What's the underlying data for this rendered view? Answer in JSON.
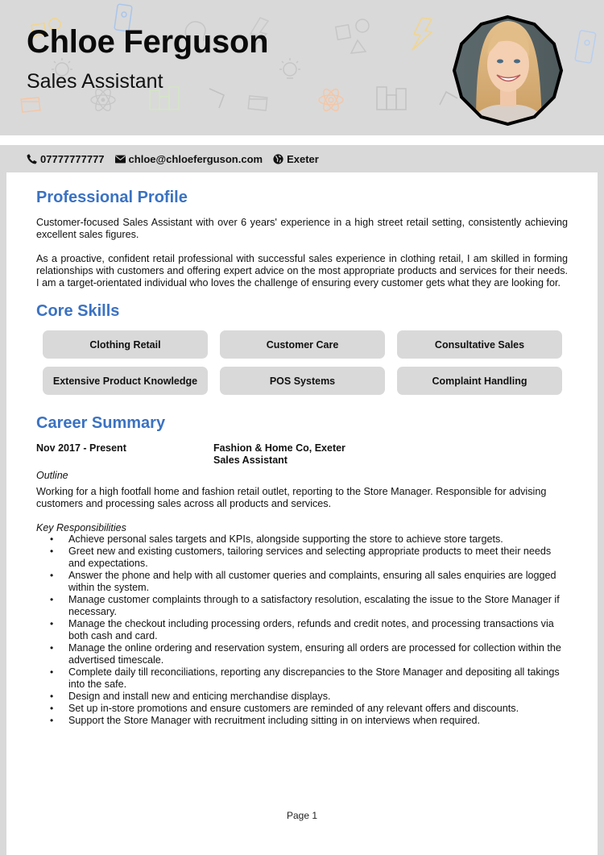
{
  "header": {
    "name": "Chloe Ferguson",
    "job_title": "Sales Assistant",
    "photo_icon": "profile-photo"
  },
  "contact": {
    "phone": {
      "icon": "phone-icon",
      "value": "07777777777"
    },
    "email": {
      "icon": "envelope-icon",
      "value": "chloe@chloeferguson.com"
    },
    "location": {
      "icon": "globe-icon",
      "value": "Exeter"
    }
  },
  "profile": {
    "heading": "Professional Profile",
    "paragraphs": [
      "Customer-focused Sales Assistant with over 6 years' experience in a high street retail setting, consistently achieving excellent sales figures.",
      "As a proactive, confident retail professional with successful sales experience in clothing retail, I am skilled in forming relationships with customers and offering expert advice on the most appropriate products and services for their needs. I am a target-orientated individual who loves the challenge of ensuring every customer gets what they are looking for."
    ]
  },
  "skills": {
    "heading": "Core Skills",
    "items": [
      "Clothing Retail",
      "Customer Care",
      "Consultative Sales",
      "Extensive Product Knowledge",
      "POS Systems",
      "Complaint Handling"
    ]
  },
  "career": {
    "heading": "Career Summary",
    "jobs": [
      {
        "dates": "Nov 2017 - Present",
        "employer": "Fashion & Home Co, Exeter",
        "role": "Sales Assistant",
        "outline_label": "Outline",
        "outline": "Working for a high footfall home and fashion retail outlet, reporting to the Store Manager. Responsible for advising customers and processing sales across all products and services.",
        "responsibilities_label": "Key Responsibilities",
        "responsibilities": [
          "Achieve personal sales targets and KPIs, alongside supporting the store to achieve store targets.",
          "Greet new and existing customers, tailoring services and selecting appropriate products to meet their needs and expectations.",
          "Answer the phone and help with all customer queries and complaints, ensuring all sales enquiries are logged within the system.",
          "Manage customer complaints through to a satisfactory resolution, escalating the issue to the Store Manager if necessary.",
          "Manage the checkout including processing orders, refunds and credit notes, and processing transactions via both cash and card.",
          "Manage the online ordering and reservation system, ensuring all orders are processed for collection within the advertised timescale.",
          "Complete daily till reconciliations, reporting any discrepancies to the Store Manager and depositing all takings into the safe.",
          "Design and install new and enticing merchandise displays.",
          "Set up in-store promotions and ensure customers are reminded of any relevant offers and discounts.",
          "Support the Store Manager with recruitment including sitting in on interviews when required."
        ]
      }
    ]
  },
  "footer": {
    "page_label": "Page 1"
  },
  "colors": {
    "accent": "#3b72c2",
    "band": "#d9d9d9"
  }
}
